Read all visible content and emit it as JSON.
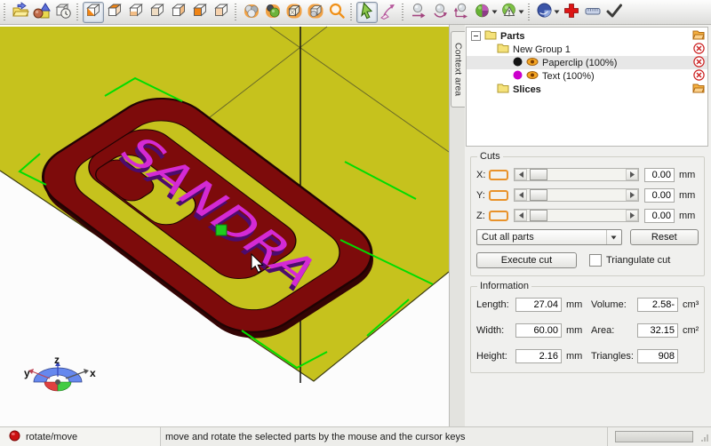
{
  "toolbar": {
    "icons": [
      "open-file",
      "add-primitive",
      "part-info",
      "view-iso",
      "view-top",
      "view-bottom",
      "view-left",
      "view-back",
      "view-front",
      "view-right",
      "shaded-parts",
      "shaded-selection",
      "wireframe-view",
      "points-view",
      "zoom",
      "select-cursor",
      "transform-arrow",
      "move-part",
      "rotate-part",
      "move-axes",
      "analysis-sphere",
      "repair-sphere",
      "slice-sphere",
      "add-cross",
      "measure",
      "apply-check"
    ],
    "accent_color": "#f08a1e"
  },
  "context_tab": {
    "label": "Context area"
  },
  "tree": {
    "items": [
      {
        "label": "Parts"
      },
      {
        "label": "New Group 1"
      },
      {
        "label": "Paperclip (100%)"
      },
      {
        "label": "Text (100%)"
      },
      {
        "label": "Slices"
      }
    ]
  },
  "cuts": {
    "title": "Cuts",
    "axes": [
      {
        "label": "X:",
        "value": "0.00",
        "unit": "mm"
      },
      {
        "label": "Y:",
        "value": "0.00",
        "unit": "mm"
      },
      {
        "label": "Z:",
        "value": "0.00",
        "unit": "mm"
      }
    ],
    "mode_dropdown": "Cut all parts",
    "reset_label": "Reset",
    "execute_label": "Execute cut",
    "triangulate_label": "Triangulate cut"
  },
  "information": {
    "title": "Information",
    "fields_left": [
      {
        "label": "Length:",
        "value": "27.04",
        "unit": "mm"
      },
      {
        "label": "Width:",
        "value": "60.00",
        "unit": "mm"
      },
      {
        "label": "Height:",
        "value": "2.16",
        "unit": "mm"
      }
    ],
    "fields_right": [
      {
        "label": "Volume:",
        "value": "2.58-",
        "unit": "cm³"
      },
      {
        "label": "Area:",
        "value": "32.15",
        "unit": "cm²"
      },
      {
        "label": "Triangles:",
        "value": "908",
        "unit": ""
      }
    ]
  },
  "viewport": {
    "model_text": "SANDRA",
    "axis_labels": {
      "x": "x",
      "y": "y",
      "z": "z"
    },
    "colors": {
      "platform": "#c6c21d",
      "model": "#7d0b0b",
      "model_shadow": "#330404",
      "text": "#d42ad4",
      "text_shadow": "#4d0b6e",
      "selection_green": "#00dd00"
    }
  },
  "statusbar": {
    "mode": "rotate/move",
    "hint": "move and rotate the selected parts by the mouse and the cursor keys"
  }
}
